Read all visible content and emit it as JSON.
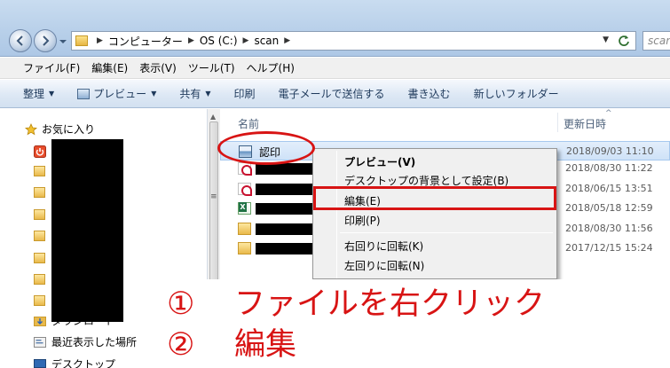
{
  "address": {
    "crumbs": [
      "コンピューター",
      "OS (C:)",
      "scan"
    ],
    "search_placeholder": "scan"
  },
  "menubar": [
    "ファイル(F)",
    "編集(E)",
    "表示(V)",
    "ツール(T)",
    "ヘルプ(H)"
  ],
  "toolbar": {
    "organize": "整理",
    "preview": "プレビュー",
    "share": "共有",
    "print": "印刷",
    "email": "電子メールで送信する",
    "burn": "書き込む",
    "new_folder": "新しいフォルダー"
  },
  "navpane": {
    "favorites": "お気に入り",
    "downloads": "ダウンロード",
    "recent": "最近表示した場所",
    "desktop": "デスクトップ"
  },
  "filelist": {
    "col_name": "名前",
    "col_date": "更新日時",
    "rows": [
      {
        "icon": "image-file-icon",
        "name": "認印",
        "date": "2018/09/03 11:10",
        "selected": true
      },
      {
        "icon": "pdf-file-icon",
        "name": "",
        "date": "2018/08/30 11:22"
      },
      {
        "icon": "pdf-file-icon",
        "name": "",
        "date": "2018/06/15 13:51"
      },
      {
        "icon": "excel-file-icon",
        "name": "",
        "date": "2018/05/18 12:59"
      },
      {
        "icon": "folder-icon",
        "name": "",
        "date": "2018/08/30 11:56"
      },
      {
        "icon": "folder-icon",
        "name": "",
        "date": "2017/12/15 15:24"
      }
    ]
  },
  "context_menu": {
    "items": [
      {
        "label": "プレビュー(V)",
        "bold": true
      },
      {
        "label": "デスクトップの背景として設定(B)"
      },
      {
        "label": "編集(E)"
      },
      {
        "label": "印刷(P)"
      },
      {
        "label": "右回りに回転(K)"
      },
      {
        "label": "左回りに回転(N)"
      }
    ]
  },
  "instructions": {
    "step1_num": "①",
    "step1_text": "ファイルを右クリック",
    "step2_num": "②",
    "step2_text": "編集"
  },
  "colors": {
    "annotation_red": "#d81414",
    "selection_blue": "#cfe2f8"
  }
}
